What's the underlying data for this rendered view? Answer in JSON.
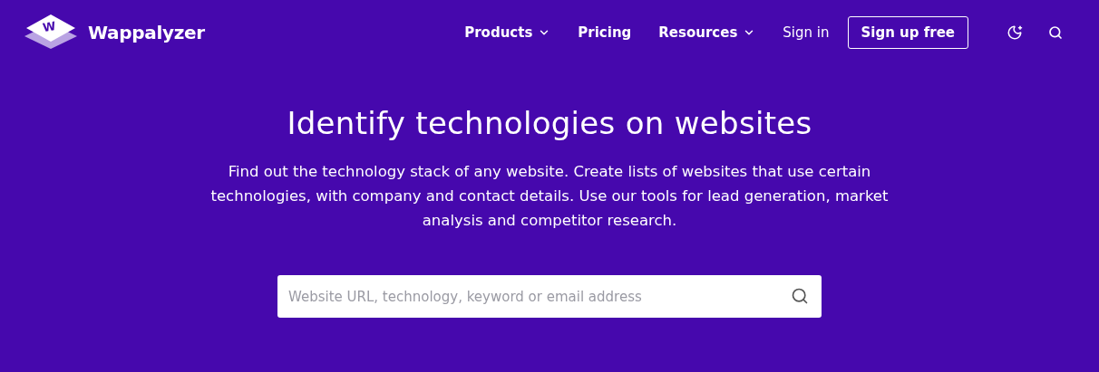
{
  "logo": {
    "mark": "W",
    "name": "Wappalyzer"
  },
  "nav": [
    {
      "label": "Products",
      "kind": "menu"
    },
    {
      "label": "Pricing",
      "kind": "link"
    },
    {
      "label": "Resources",
      "kind": "menu"
    },
    {
      "label": "Sign in",
      "kind": "plain"
    },
    {
      "label": "Sign up free",
      "kind": "outlined"
    }
  ],
  "hero": {
    "title": "Identify technologies on websites",
    "text": "Find out the technology stack of any website. Create lists of websites that use certain technologies, with company and contact details. Use our tools for lead generation, market analysis and competitor research."
  },
  "search": {
    "placeholder": "Website URL, technology, keyword or email address"
  }
}
